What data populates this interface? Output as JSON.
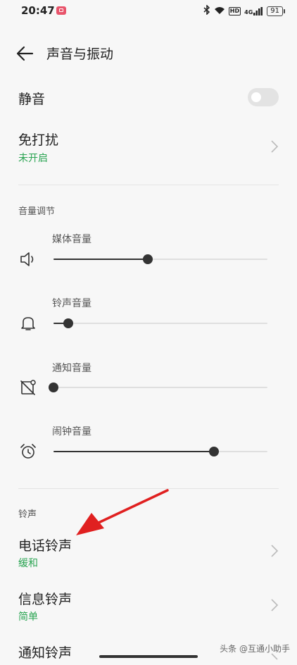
{
  "status_bar": {
    "time": "20:47",
    "hd_label": "HD",
    "network_label": "4G",
    "battery": "91",
    "icons": [
      "notification-app-icon",
      "bluetooth-icon",
      "wifi-icon",
      "hd-icon",
      "signal-icon",
      "battery-icon"
    ]
  },
  "header": {
    "title": "声音与振动",
    "back_icon": "back-arrow-icon"
  },
  "mute": {
    "label": "静音",
    "toggle_on": false
  },
  "dnd": {
    "label": "免打扰",
    "status": "未开启"
  },
  "volume_section": {
    "header": "音量调节",
    "sliders": [
      {
        "label": "媒体音量",
        "icon": "speaker-icon",
        "level": 0.44
      },
      {
        "label": "铃声音量",
        "icon": "bell-icon",
        "level": 0.07
      },
      {
        "label": "通知音量",
        "icon": "notification-icon",
        "level": 0.0
      },
      {
        "label": "闹钟音量",
        "icon": "alarm-clock-icon",
        "level": 0.75
      }
    ]
  },
  "ringtone_section": {
    "header": "铃声",
    "items": [
      {
        "label": "电话铃声",
        "value": "缓和"
      },
      {
        "label": "信息铃声",
        "value": "简单"
      },
      {
        "label": "通知铃声",
        "value": ""
      }
    ]
  },
  "colors": {
    "accent_green": "#2aa452",
    "annotation_red": "#e02020",
    "background": "#f7f7f7"
  },
  "watermark": "头条 @互通小助手"
}
